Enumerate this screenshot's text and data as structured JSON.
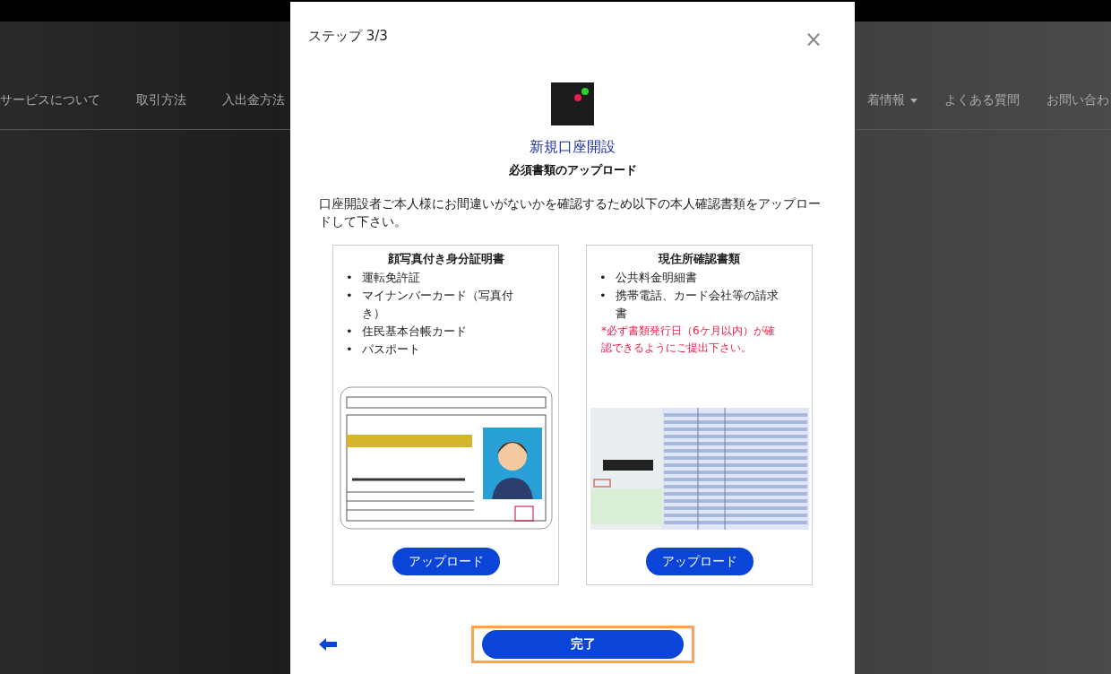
{
  "background_nav": {
    "left_items": [
      "サービスについて",
      "取引方法",
      "入出金方法"
    ],
    "right_items": [
      {
        "label": "着情報",
        "dropdown": true
      },
      {
        "label": "よくある質問",
        "dropdown": false
      },
      {
        "label": "お問い合わ",
        "dropdown": false
      }
    ]
  },
  "dialog": {
    "step": "ステップ 3/3",
    "close": "×",
    "title": "新規口座開設",
    "subtitle": "必須書類のアップロード",
    "description": "口座開設者ご本人様にお間違いがないかを確認するため以下の本人確認書類をアップロードして下さい。",
    "cards": [
      {
        "kind": "license",
        "bullet": "•",
        "title": "顔写真付き身分証明書",
        "items": [
          "運転免許証",
          "マイナンバーカード（写真付き）",
          "住民基本台帳カード",
          "パスポート"
        ],
        "button": "アップロード"
      },
      {
        "kind": "bill",
        "bullet": "•",
        "title": "現住所確認書類",
        "items": [
          "公共料金明細書",
          "携帯電話、カード会社等の請求書"
        ],
        "note": "*必ず書類発行日（6ケ月以内）が確認できるようにご提出下さい。",
        "button": "アップロード"
      }
    ],
    "done_button": {
      "label": "完了",
      "focused": true
    }
  }
}
